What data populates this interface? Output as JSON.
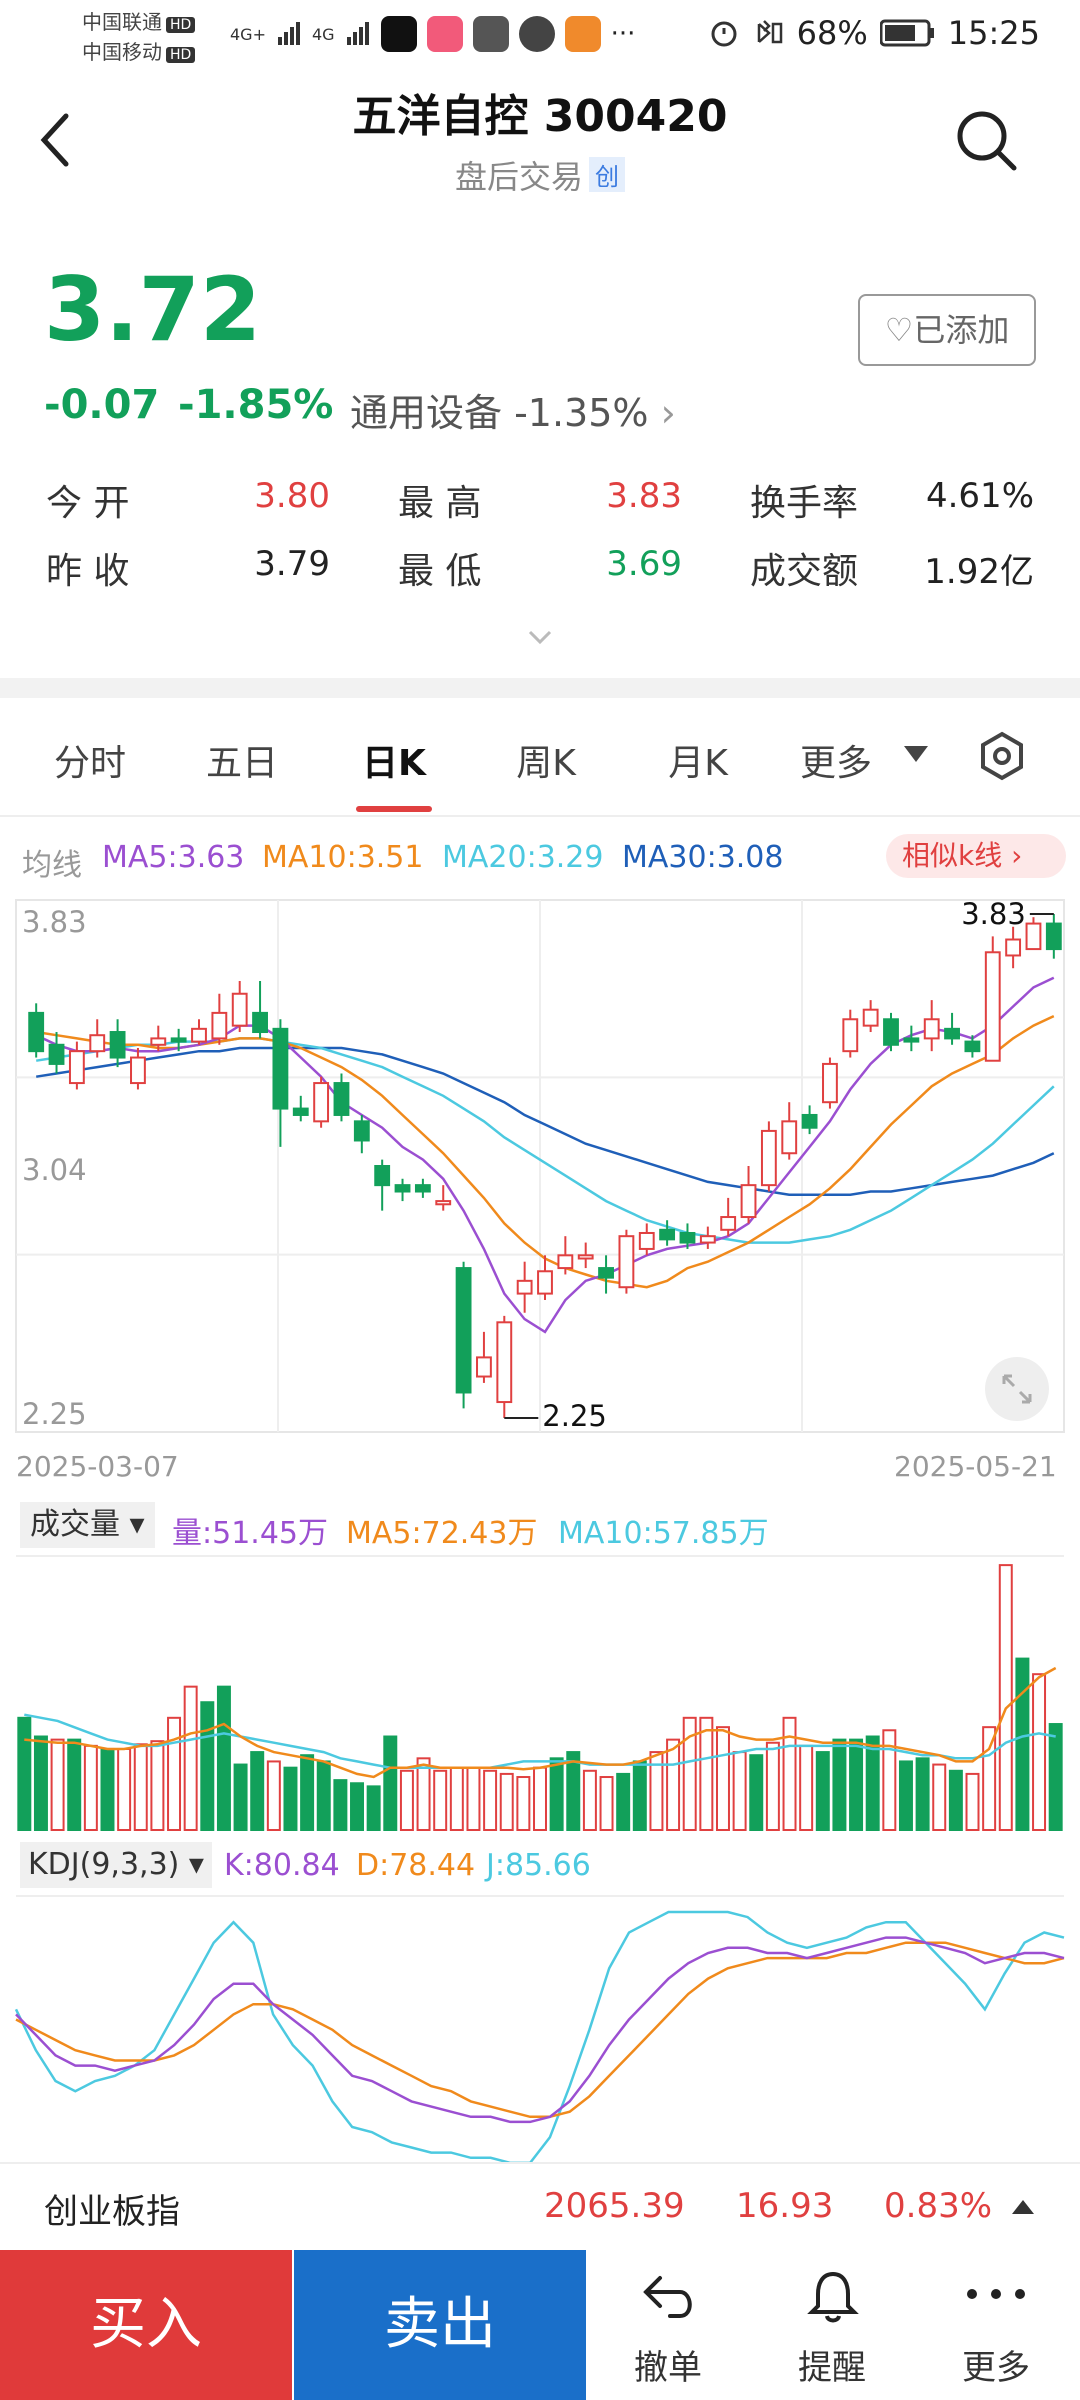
{
  "status_bar": {
    "carrier1": "中国联通",
    "carrier2": "中国移动",
    "hd_badge": "HD",
    "network1": "4G+",
    "network2": "4G",
    "more_icons": "···",
    "battery": "68%",
    "time": "15:25"
  },
  "header": {
    "stock_name": "五洋自控 300420",
    "status": "盘后交易",
    "board_badge": "创"
  },
  "quote": {
    "price": "3.72",
    "change": "-0.07",
    "change_pct": "-1.85%",
    "industry": "通用设备 -1.35%",
    "added_label": "已添加",
    "open_label": "今 开",
    "open": "3.80",
    "high_label": "最 高",
    "high": "3.83",
    "turnover_label": "换手率",
    "turnover": "4.61%",
    "prev_label": "昨 收",
    "prev": "3.79",
    "low_label": "最 低",
    "low": "3.69",
    "amount_label": "成交额",
    "amount": "1.92亿"
  },
  "tabs": [
    "分时",
    "五日",
    "日K",
    "周K",
    "月K",
    "更多"
  ],
  "active_tab": "日K",
  "ma_legend": {
    "label": "均线",
    "ma5": "MA5:3.63",
    "ma10": "MA10:3.51",
    "ma20": "MA20:3.29",
    "ma30": "MA30:3.08",
    "similar_k": "相似k线"
  },
  "chart_labels": {
    "y_top": "3.83",
    "y_mid": "3.04",
    "y_bottom": "2.25",
    "high_marker": "3.83",
    "low_marker": "2.25",
    "date_start": "2025-03-07",
    "date_end": "2025-05-21"
  },
  "volume_legend": {
    "selector": "成交量",
    "vol": "量:51.45万",
    "ma5": "MA5:72.43万",
    "ma10": "MA10:57.85万"
  },
  "kdj_legend": {
    "selector": "KDJ(9,3,3)",
    "k": "K:80.84",
    "d": "D:78.44",
    "j": "J:85.66"
  },
  "index_bar": {
    "name": "创业板指",
    "value": "2065.39",
    "change": "16.93",
    "pct": "0.83%"
  },
  "bottom_bar": {
    "buy": "买入",
    "sell": "卖出",
    "cancel": "撤单",
    "alert": "提醒",
    "more": "更多"
  },
  "colors": {
    "up": "#e04040",
    "down": "#12a05a",
    "ma5": "#9b4fd1",
    "ma10": "#f08a1c",
    "ma20": "#4cc9e0",
    "ma30": "#1f5fb8",
    "buy": "#e03a3a",
    "sell": "#1a6fc9"
  },
  "chart_data": {
    "type": "candlestick",
    "title": "",
    "ylim": [
      2.25,
      3.83
    ],
    "x_range": [
      "2025-03-07",
      "2025-05-21"
    ],
    "last_values": {
      "ma5": 3.63,
      "ma10": 3.51,
      "ma20": 3.29,
      "ma30": 3.08
    },
    "candles": [
      {
        "o": 3.52,
        "c": 3.4,
        "h": 3.55,
        "l": 3.38
      },
      {
        "o": 3.42,
        "c": 3.36,
        "h": 3.46,
        "l": 3.33
      },
      {
        "o": 3.3,
        "c": 3.4,
        "h": 3.43,
        "l": 3.28
      },
      {
        "o": 3.4,
        "c": 3.45,
        "h": 3.5,
        "l": 3.38
      },
      {
        "o": 3.46,
        "c": 3.38,
        "h": 3.5,
        "l": 3.35
      },
      {
        "o": 3.3,
        "c": 3.38,
        "h": 3.41,
        "l": 3.28
      },
      {
        "o": 3.42,
        "c": 3.44,
        "h": 3.48,
        "l": 3.4
      },
      {
        "o": 3.44,
        "c": 3.43,
        "h": 3.47,
        "l": 3.4
      },
      {
        "o": 3.43,
        "c": 3.47,
        "h": 3.5,
        "l": 3.42
      },
      {
        "o": 3.44,
        "c": 3.52,
        "h": 3.58,
        "l": 3.42
      },
      {
        "o": 3.48,
        "c": 3.58,
        "h": 3.62,
        "l": 3.46
      },
      {
        "o": 3.52,
        "c": 3.46,
        "h": 3.62,
        "l": 3.44
      },
      {
        "o": 3.47,
        "c": 3.22,
        "h": 3.5,
        "l": 3.1
      },
      {
        "o": 3.22,
        "c": 3.2,
        "h": 3.26,
        "l": 3.18
      },
      {
        "o": 3.18,
        "c": 3.3,
        "h": 3.32,
        "l": 3.16
      },
      {
        "o": 3.3,
        "c": 3.2,
        "h": 3.33,
        "l": 3.18
      },
      {
        "o": 3.18,
        "c": 3.12,
        "h": 3.2,
        "l": 3.08
      },
      {
        "o": 3.04,
        "c": 2.98,
        "h": 3.06,
        "l": 2.9
      },
      {
        "o": 2.98,
        "c": 2.96,
        "h": 3.0,
        "l": 2.93
      },
      {
        "o": 2.98,
        "c": 2.96,
        "h": 3.0,
        "l": 2.94
      },
      {
        "o": 2.92,
        "c": 2.93,
        "h": 2.98,
        "l": 2.9
      },
      {
        "o": 2.72,
        "c": 2.33,
        "h": 2.74,
        "l": 2.28
      },
      {
        "o": 2.38,
        "c": 2.44,
        "h": 2.52,
        "l": 2.36
      },
      {
        "o": 2.3,
        "c": 2.55,
        "h": 2.57,
        "l": 2.25
      },
      {
        "o": 2.64,
        "c": 2.68,
        "h": 2.74,
        "l": 2.58
      },
      {
        "o": 2.64,
        "c": 2.71,
        "h": 2.76,
        "l": 2.62
      },
      {
        "o": 2.72,
        "c": 2.76,
        "h": 2.82,
        "l": 2.7
      },
      {
        "o": 2.75,
        "c": 2.76,
        "h": 2.8,
        "l": 2.72
      },
      {
        "o": 2.72,
        "c": 2.69,
        "h": 2.76,
        "l": 2.64
      },
      {
        "o": 2.66,
        "c": 2.82,
        "h": 2.84,
        "l": 2.64
      },
      {
        "o": 2.78,
        "c": 2.83,
        "h": 2.86,
        "l": 2.76
      },
      {
        "o": 2.84,
        "c": 2.81,
        "h": 2.87,
        "l": 2.79
      },
      {
        "o": 2.83,
        "c": 2.8,
        "h": 2.86,
        "l": 2.78
      },
      {
        "o": 2.8,
        "c": 2.82,
        "h": 2.85,
        "l": 2.78
      },
      {
        "o": 2.84,
        "c": 2.88,
        "h": 2.94,
        "l": 2.82
      },
      {
        "o": 2.88,
        "c": 2.98,
        "h": 3.04,
        "l": 2.86
      },
      {
        "o": 2.98,
        "c": 3.15,
        "h": 3.18,
        "l": 2.96
      },
      {
        "o": 3.08,
        "c": 3.18,
        "h": 3.24,
        "l": 3.06
      },
      {
        "o": 3.2,
        "c": 3.16,
        "h": 3.23,
        "l": 3.14
      },
      {
        "o": 3.24,
        "c": 3.36,
        "h": 3.38,
        "l": 3.22
      },
      {
        "o": 3.4,
        "c": 3.5,
        "h": 3.53,
        "l": 3.38
      },
      {
        "o": 3.48,
        "c": 3.53,
        "h": 3.56,
        "l": 3.46
      },
      {
        "o": 3.5,
        "c": 3.42,
        "h": 3.52,
        "l": 3.4
      },
      {
        "o": 3.44,
        "c": 3.43,
        "h": 3.48,
        "l": 3.4
      },
      {
        "o": 3.44,
        "c": 3.5,
        "h": 3.56,
        "l": 3.4
      },
      {
        "o": 3.47,
        "c": 3.44,
        "h": 3.52,
        "l": 3.42
      },
      {
        "o": 3.43,
        "c": 3.4,
        "h": 3.45,
        "l": 3.38
      },
      {
        "o": 3.37,
        "c": 3.71,
        "h": 3.76,
        "l": 3.37
      },
      {
        "o": 3.7,
        "c": 3.75,
        "h": 3.79,
        "l": 3.66
      },
      {
        "o": 3.72,
        "c": 3.8,
        "h": 3.82,
        "l": 3.72
      },
      {
        "o": 3.8,
        "c": 3.72,
        "h": 3.83,
        "l": 3.69
      }
    ],
    "ma5": [
      3.45,
      3.42,
      3.4,
      3.4,
      3.41,
      3.4,
      3.4,
      3.41,
      3.42,
      3.44,
      3.48,
      3.48,
      3.44,
      3.38,
      3.32,
      3.24,
      3.2,
      3.16,
      3.1,
      3.06,
      3.0,
      2.9,
      2.78,
      2.64,
      2.56,
      2.52,
      2.62,
      2.68,
      2.7,
      2.73,
      2.76,
      2.78,
      2.79,
      2.8,
      2.82,
      2.86,
      2.94,
      3.02,
      3.1,
      3.18,
      3.28,
      3.36,
      3.42,
      3.45,
      3.47,
      3.46,
      3.44,
      3.48,
      3.54,
      3.6,
      3.63
    ],
    "ma10": [
      3.46,
      3.45,
      3.44,
      3.43,
      3.42,
      3.42,
      3.41,
      3.41,
      3.42,
      3.43,
      3.44,
      3.44,
      3.43,
      3.41,
      3.38,
      3.35,
      3.31,
      3.26,
      3.2,
      3.14,
      3.08,
      3.01,
      2.94,
      2.86,
      2.8,
      2.75,
      2.72,
      2.7,
      2.68,
      2.67,
      2.66,
      2.68,
      2.72,
      2.74,
      2.77,
      2.8,
      2.84,
      2.88,
      2.92,
      2.97,
      3.03,
      3.1,
      3.17,
      3.23,
      3.29,
      3.33,
      3.36,
      3.39,
      3.44,
      3.48,
      3.51
    ],
    "ma20": [
      3.37,
      3.38,
      3.39,
      3.4,
      3.41,
      3.42,
      3.42,
      3.43,
      3.43,
      3.43,
      3.44,
      3.44,
      3.43,
      3.42,
      3.41,
      3.39,
      3.37,
      3.35,
      3.32,
      3.29,
      3.26,
      3.22,
      3.18,
      3.13,
      3.09,
      3.05,
      3.01,
      2.97,
      2.93,
      2.9,
      2.87,
      2.85,
      2.83,
      2.82,
      2.81,
      2.8,
      2.8,
      2.8,
      2.81,
      2.82,
      2.84,
      2.87,
      2.9,
      2.94,
      2.98,
      3.02,
      3.06,
      3.11,
      3.17,
      3.23,
      3.29
    ],
    "ma30": [
      3.32,
      3.33,
      3.34,
      3.35,
      3.36,
      3.37,
      3.38,
      3.39,
      3.4,
      3.4,
      3.41,
      3.41,
      3.41,
      3.41,
      3.41,
      3.41,
      3.4,
      3.39,
      3.37,
      3.35,
      3.33,
      3.3,
      3.27,
      3.24,
      3.2,
      3.17,
      3.14,
      3.11,
      3.09,
      3.07,
      3.05,
      3.03,
      3.01,
      2.99,
      2.98,
      2.97,
      2.96,
      2.95,
      2.95,
      2.95,
      2.95,
      2.96,
      2.96,
      2.97,
      2.98,
      2.99,
      3.0,
      3.01,
      3.03,
      3.05,
      3.08
    ],
    "volume": [
      72,
      60,
      58,
      58,
      54,
      52,
      52,
      55,
      57,
      72,
      92,
      82,
      92,
      42,
      50,
      44,
      40,
      48,
      44,
      32,
      30,
      28,
      60,
      38,
      46,
      38,
      40,
      40,
      38,
      36,
      34,
      40,
      46,
      50,
      38,
      34,
      36,
      44,
      50,
      58,
      72,
      72,
      66,
      50,
      48,
      56,
      72,
      54,
      50,
      58,
      58,
      60,
      64,
      44,
      46,
      42,
      38,
      36,
      66,
      170,
      110,
      100,
      68
    ],
    "vol_ma5": [
      58,
      57,
      56,
      56,
      54,
      52,
      52,
      54,
      55,
      58,
      62,
      64,
      68,
      60,
      54,
      50,
      48,
      46,
      44,
      40,
      36,
      34,
      40,
      40,
      42,
      40,
      40,
      40,
      40,
      40,
      39,
      40,
      42,
      44,
      43,
      42,
      42,
      44,
      48,
      52,
      60,
      64,
      64,
      60,
      58,
      58,
      60,
      58,
      56,
      56,
      56,
      54,
      54,
      52,
      50,
      48,
      44,
      44,
      52,
      78,
      88,
      98,
      104
    ],
    "vol_ma10": [
      74,
      72,
      70,
      66,
      62,
      58,
      56,
      54,
      54,
      56,
      58,
      60,
      62,
      60,
      58,
      56,
      54,
      52,
      50,
      46,
      44,
      42,
      40,
      40,
      40,
      40,
      40,
      40,
      40,
      42,
      44,
      44,
      44,
      44,
      42,
      42,
      42,
      42,
      42,
      42,
      44,
      46,
      48,
      50,
      52,
      52,
      54,
      54,
      54,
      54,
      54,
      52,
      52,
      50,
      48,
      48,
      46,
      46,
      48,
      56,
      60,
      62,
      60
    ],
    "kdj_k": [
      60,
      52,
      44,
      40,
      40,
      38,
      40,
      42,
      48,
      56,
      66,
      72,
      72,
      64,
      58,
      52,
      44,
      36,
      34,
      30,
      26,
      24,
      22,
      20,
      20,
      18,
      18,
      20,
      26,
      36,
      48,
      58,
      66,
      74,
      80,
      84,
      86,
      86,
      84,
      84,
      82,
      84,
      86,
      88,
      90,
      90,
      88,
      86,
      84,
      80,
      82,
      84,
      84,
      82
    ],
    "kdj_d": [
      58,
      54,
      50,
      46,
      44,
      42,
      42,
      42,
      44,
      48,
      54,
      60,
      64,
      64,
      62,
      58,
      54,
      48,
      44,
      40,
      36,
      32,
      30,
      26,
      24,
      22,
      20,
      20,
      22,
      28,
      36,
      44,
      52,
      60,
      68,
      74,
      78,
      80,
      82,
      82,
      82,
      82,
      84,
      84,
      86,
      88,
      88,
      88,
      86,
      84,
      82,
      80,
      80,
      82
    ],
    "kdj_j": [
      62,
      46,
      34,
      30,
      34,
      36,
      40,
      46,
      60,
      74,
      88,
      96,
      88,
      60,
      48,
      40,
      26,
      16,
      14,
      10,
      8,
      6,
      6,
      4,
      4,
      2,
      2,
      12,
      32,
      54,
      78,
      92,
      96,
      100,
      100,
      100,
      100,
      98,
      92,
      88,
      86,
      88,
      90,
      94,
      96,
      96,
      88,
      80,
      72,
      62,
      76,
      88,
      92,
      90
    ]
  }
}
